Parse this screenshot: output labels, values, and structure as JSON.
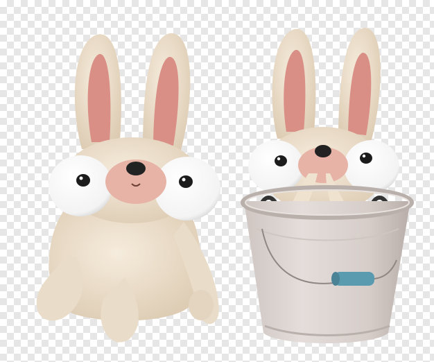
{
  "image": {
    "background": "transparency-checkerboard",
    "subjects": [
      "bunny-sitting",
      "bunny-in-bucket"
    ]
  },
  "colors": {
    "fur": "#efe2cf",
    "fur_shadow": "#d9c6ad",
    "inner_ear": "#d98f86",
    "nose_pad": "#e7b3a6",
    "nose": "#222222",
    "eye_white": "#ffffff",
    "pupil": "#1c1c1c",
    "bucket": "#d9d2cf",
    "bucket_shadow": "#b9afab",
    "handle_grip": "#5a9bb0"
  }
}
